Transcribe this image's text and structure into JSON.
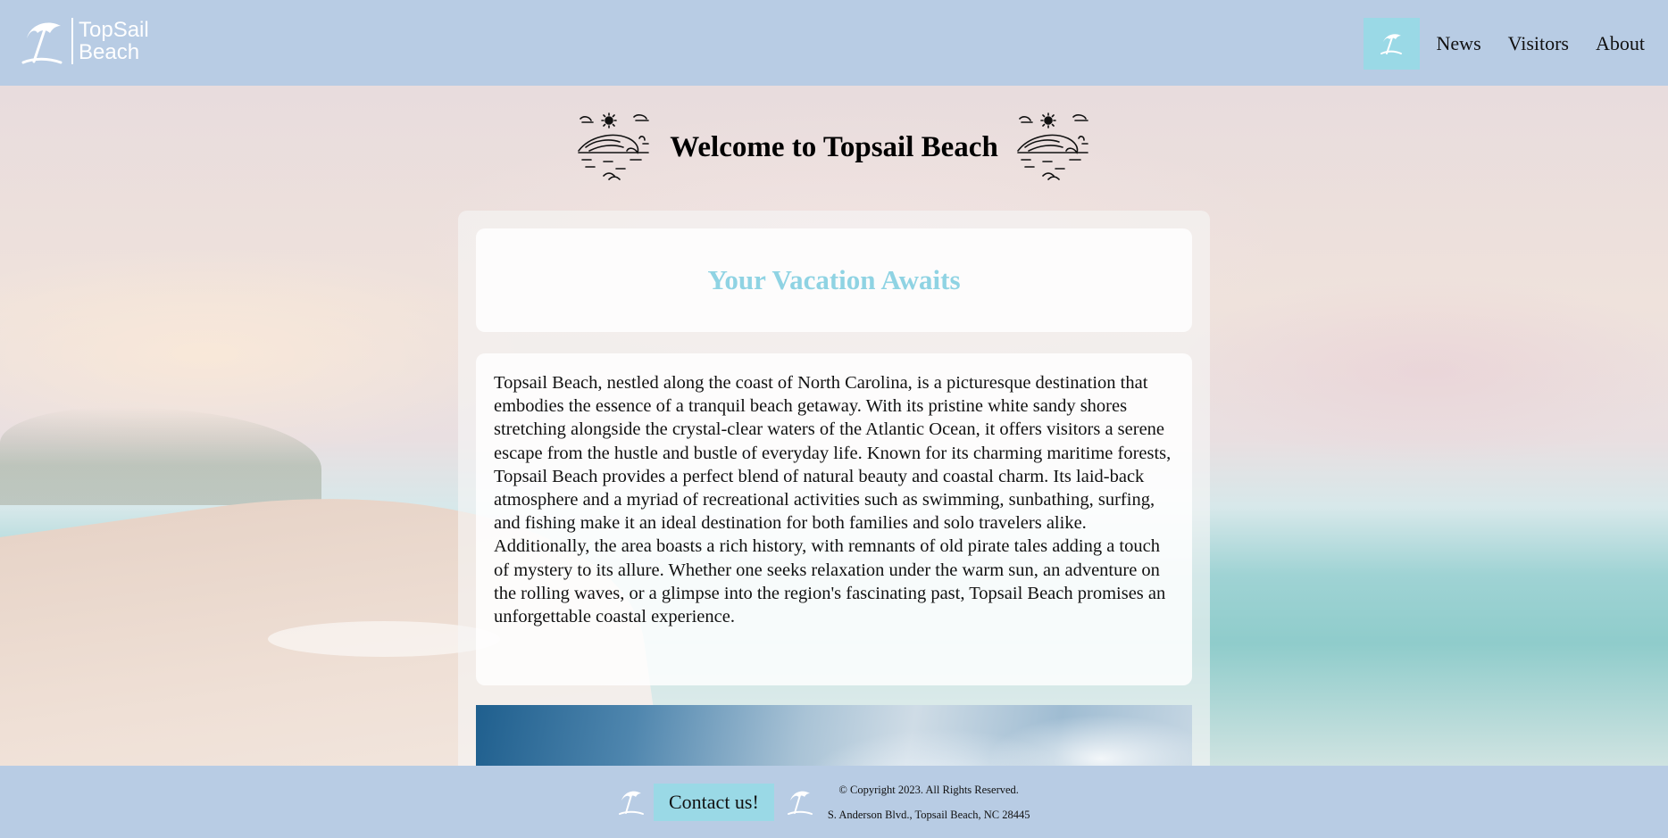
{
  "header": {
    "logo": {
      "line1": "TopSail",
      "line2": "Beach"
    },
    "nav": {
      "home_icon": "beach-umbrella-icon",
      "items": [
        {
          "label": "News"
        },
        {
          "label": "Visitors"
        },
        {
          "label": "About"
        }
      ]
    }
  },
  "main": {
    "title": "Welcome to Topsail Beach",
    "title_icons": [
      "sun-wave-icon",
      "sun-wave-icon"
    ],
    "subtitle": "Your Vacation Awaits",
    "description": "Topsail Beach, nestled along the coast of North Carolina, is a picturesque destination that embodies the essence of a tranquil beach getaway. With its pristine white sandy shores stretching alongside the crystal-clear waters of the Atlantic Ocean, it offers visitors a serene escape from the hustle and bustle of everyday life. Known for its charming maritime forests, Topsail Beach provides a perfect blend of natural beauty and coastal charm. Its laid-back atmosphere and a myriad of recreational activities such as swimming, sunbathing, surfing, and fishing make it an ideal destination for both families and solo travelers alike. Additionally, the area boasts a rich history, with remnants of old pirate tales adding a touch of mystery to its allure. Whether one seeks relaxation under the warm sun, an adventure on the rolling waves, or a glimpse into the region's fascinating past, Topsail Beach promises an unforgettable coastal experience."
  },
  "footer": {
    "contact_label": "Contact us!",
    "copyright": "© Copyright 2023. All Rights Reserved.",
    "address": "S. Anderson Blvd., Topsail Beach, NC 28445"
  },
  "colors": {
    "header_bg": "#b8cce4",
    "accent": "#9ad9e6",
    "subtitle": "#8fd3e3"
  }
}
